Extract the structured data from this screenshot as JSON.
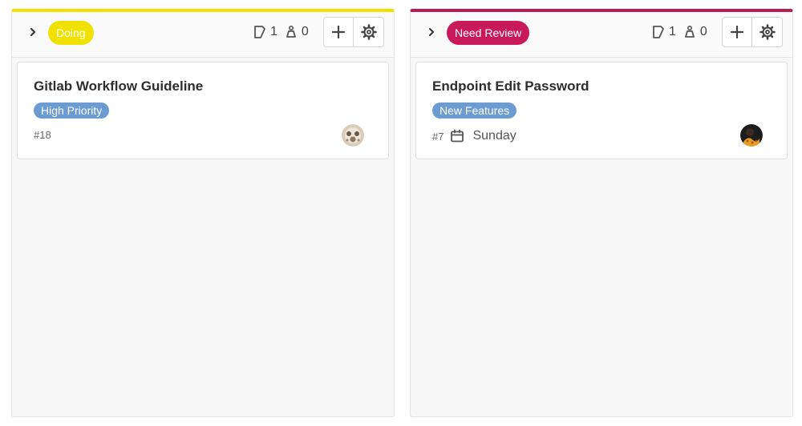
{
  "columns": [
    {
      "label": "Doing",
      "label_color": "#f0e100",
      "label_text_color": "#ffffff",
      "accent_color": "#f0e100",
      "issue_count": "1",
      "weight_count": "0",
      "add_icon": "plus-icon",
      "settings_icon": "gear-icon",
      "cards": [
        {
          "title": "Gitlab Workflow Guideline",
          "label": "High Priority",
          "label_color": "#6b9bd1",
          "number": "#18",
          "due_date": ""
        }
      ]
    },
    {
      "label": "Need Review",
      "label_color": "#c8195a",
      "label_text_color": "#ffffff",
      "accent_color": "#b51d55",
      "issue_count": "1",
      "weight_count": "0",
      "add_icon": "plus-icon",
      "settings_icon": "gear-icon",
      "cards": [
        {
          "title": "Endpoint Edit Password",
          "label": "New Features",
          "label_color": "#6b9bd1",
          "number": "#7",
          "due_date": "Sunday"
        }
      ]
    }
  ]
}
